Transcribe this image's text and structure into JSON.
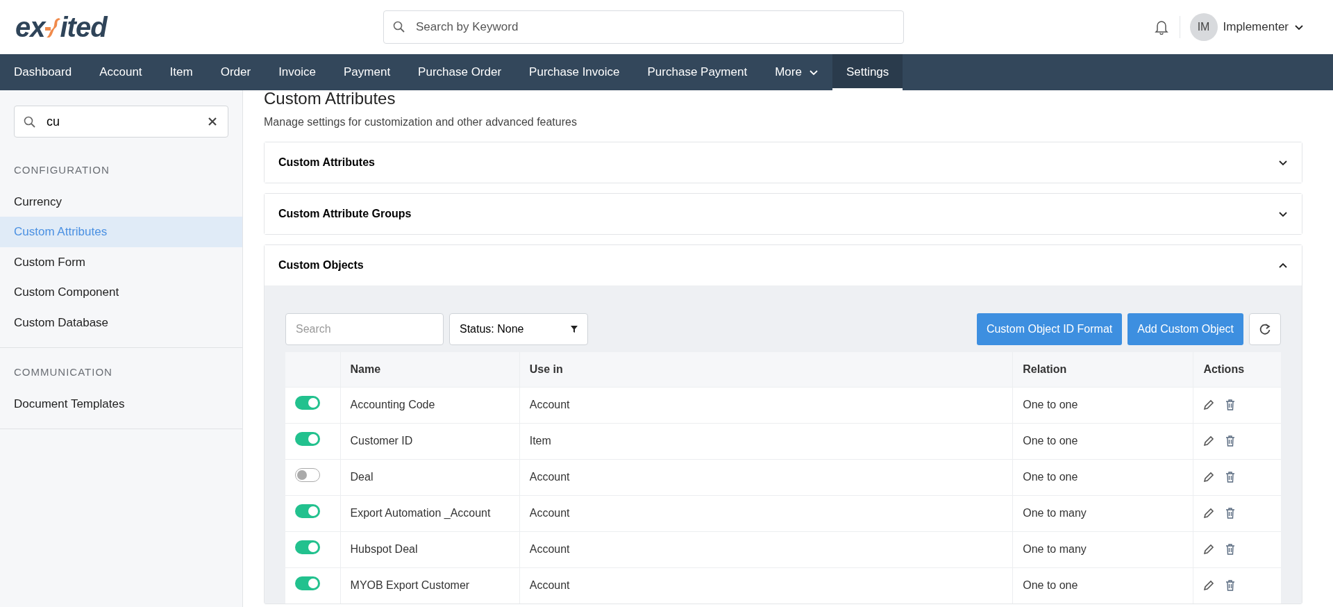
{
  "header": {
    "logo": {
      "left": "ex",
      "right": "ited"
    },
    "search": {
      "placeholder": "Search by Keyword"
    },
    "user": {
      "initials": "IM",
      "name": "Implementer"
    }
  },
  "nav": [
    {
      "label": "Dashboard",
      "selected": false,
      "dropdown": false
    },
    {
      "label": "Account",
      "selected": false,
      "dropdown": false
    },
    {
      "label": "Item",
      "selected": false,
      "dropdown": false
    },
    {
      "label": "Order",
      "selected": false,
      "dropdown": false
    },
    {
      "label": "Invoice",
      "selected": false,
      "dropdown": false
    },
    {
      "label": "Payment",
      "selected": false,
      "dropdown": false
    },
    {
      "label": "Purchase Order",
      "selected": false,
      "dropdown": false
    },
    {
      "label": "Purchase Invoice",
      "selected": false,
      "dropdown": false
    },
    {
      "label": "Purchase Payment",
      "selected": false,
      "dropdown": false
    },
    {
      "label": "More",
      "selected": false,
      "dropdown": true
    },
    {
      "label": "Settings",
      "selected": true,
      "dropdown": false
    }
  ],
  "sidebar": {
    "search": {
      "value": "cu"
    },
    "groups": [
      {
        "title": "CONFIGURATION",
        "items": [
          {
            "label": "Currency",
            "selected": false
          },
          {
            "label": "Custom Attributes",
            "selected": true
          },
          {
            "label": "Custom Form",
            "selected": false
          },
          {
            "label": "Custom Component",
            "selected": false
          },
          {
            "label": "Custom Database",
            "selected": false
          }
        ]
      },
      {
        "title": "COMMUNICATION",
        "items": [
          {
            "label": "Document Templates",
            "selected": false
          }
        ]
      }
    ]
  },
  "page": {
    "title": "Custom Attributes",
    "subtitle": "Manage settings for customization and other advanced features"
  },
  "sections": [
    {
      "title": "Custom Attributes",
      "expanded": false
    },
    {
      "title": "Custom Attribute Groups",
      "expanded": false
    },
    {
      "title": "Custom Objects",
      "expanded": true
    }
  ],
  "toolbar": {
    "search": {
      "placeholder": "Search"
    },
    "status_filter": "Status: None",
    "buttons": [
      "Custom Object ID Format",
      "Add Custom Object"
    ]
  },
  "table": {
    "columns": [
      "Name",
      "Use in",
      "Relation",
      "Actions"
    ],
    "rows": [
      {
        "on": true,
        "name": "Accounting Code",
        "use_in": "Account",
        "relation": "One to one"
      },
      {
        "on": true,
        "name": "Customer ID",
        "use_in": "Item",
        "relation": "One to one"
      },
      {
        "on": false,
        "name": "Deal",
        "use_in": "Account",
        "relation": "One to one"
      },
      {
        "on": true,
        "name": "Export Automation _Account",
        "use_in": "Account",
        "relation": "One to many"
      },
      {
        "on": true,
        "name": "Hubspot Deal",
        "use_in": "Account",
        "relation": "One to many"
      },
      {
        "on": true,
        "name": "MYOB Export Customer",
        "use_in": "Account",
        "relation": "One to one"
      }
    ]
  }
}
